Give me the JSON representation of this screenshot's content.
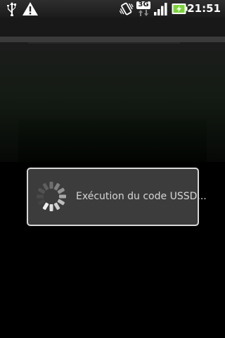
{
  "status_bar": {
    "icons_left": [
      "usb-icon",
      "warning-icon"
    ],
    "icons_right": [
      "vibrate-icon",
      "3g-data-icon",
      "signal-icon",
      "battery-charging-icon"
    ],
    "network_type": "3G",
    "time": "21:51"
  },
  "dialog": {
    "message": "Exécution du code USSD...",
    "spinner": "loading-spinner-icon"
  },
  "colors": {
    "dialog_background": "#3c3c3c",
    "dialog_border": "#d8d8d8",
    "battery_accent": "#7ad33a"
  }
}
